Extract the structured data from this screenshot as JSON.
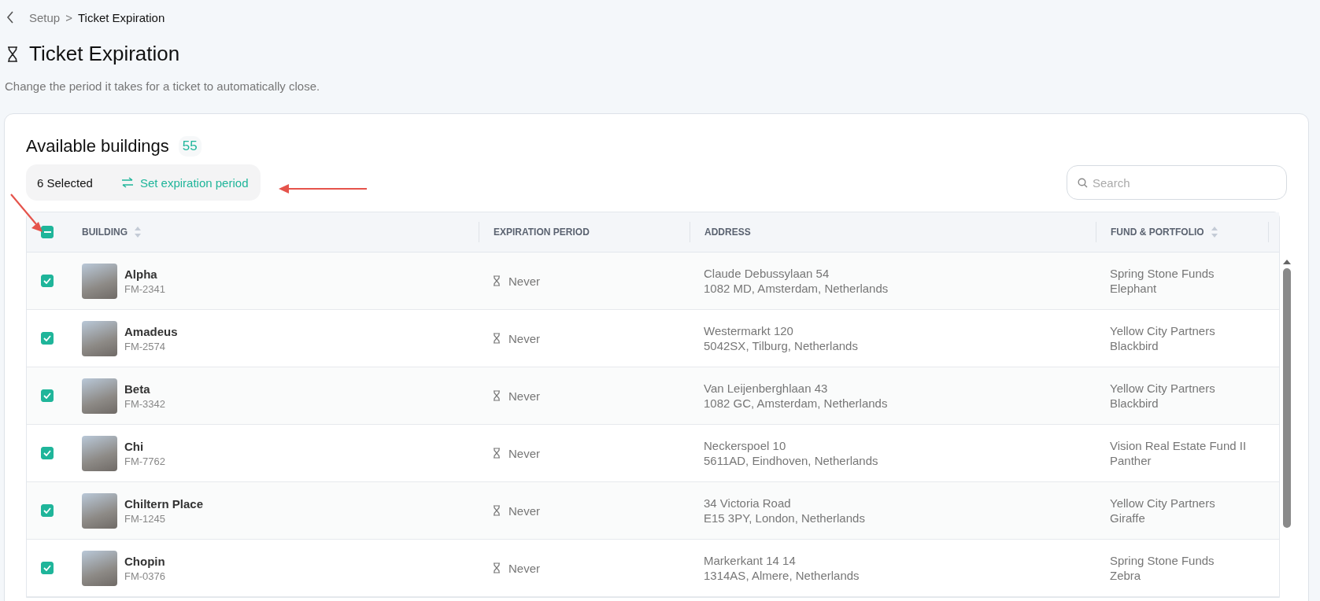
{
  "breadcrumb": {
    "parent": "Setup",
    "separator": ">",
    "current": "Ticket Expiration"
  },
  "page": {
    "title": "Ticket Expiration",
    "description": "Change the period it takes for a ticket to automatically close."
  },
  "card": {
    "title": "Available buildings",
    "count": "55"
  },
  "selection": {
    "count_label": "6 Selected",
    "action": "Set expiration period"
  },
  "search": {
    "placeholder": "Search"
  },
  "table": {
    "select_all": {
      "indeterminate": true
    },
    "columns": [
      {
        "label": "BUILDING",
        "sortable": true
      },
      {
        "label": "EXPIRATION PERIOD",
        "sortable": false
      },
      {
        "label": "ADDRESS",
        "sortable": false
      },
      {
        "label": "FUND & PORTFOLIO",
        "sortable": true
      }
    ],
    "rows": [
      {
        "checked": true,
        "name": "Alpha",
        "code": "FM-2341",
        "expiration": "Never",
        "address_line1": "Claude Debussylaan 54",
        "address_line2": "1082 MD, Amsterdam, Netherlands",
        "fund": "Spring Stone Funds",
        "portfolio": "Elephant"
      },
      {
        "checked": true,
        "name": "Amadeus",
        "code": "FM-2574",
        "expiration": "Never",
        "address_line1": "Westermarkt 120",
        "address_line2": "5042SX, Tilburg, Netherlands",
        "fund": "Yellow City Partners",
        "portfolio": "Blackbird"
      },
      {
        "checked": true,
        "name": "Beta",
        "code": "FM-3342",
        "expiration": "Never",
        "address_line1": "Van Leijenberghlaan 43",
        "address_line2": "1082 GC, Amsterdam, Netherlands",
        "fund": "Yellow City Partners",
        "portfolio": "Blackbird"
      },
      {
        "checked": true,
        "name": "Chi",
        "code": "FM-7762",
        "expiration": "Never",
        "address_line1": "Neckerspoel 10",
        "address_line2": "5611AD, Eindhoven, Netherlands",
        "fund": "Vision Real Estate Fund II",
        "portfolio": "Panther"
      },
      {
        "checked": true,
        "name": "Chiltern Place",
        "code": "FM-1245",
        "expiration": "Never",
        "address_line1": "34 Victoria Road",
        "address_line2": "E15 3PY, London, Netherlands",
        "fund": "Yellow City Partners",
        "portfolio": "Giraffe"
      },
      {
        "checked": true,
        "name": "Chopin",
        "code": "FM-0376",
        "expiration": "Never",
        "address_line1": "Markerkant 14 14",
        "address_line2": "1314AS, Almere, Netherlands",
        "fund": "Spring Stone Funds",
        "portfolio": "Zebra"
      }
    ]
  }
}
